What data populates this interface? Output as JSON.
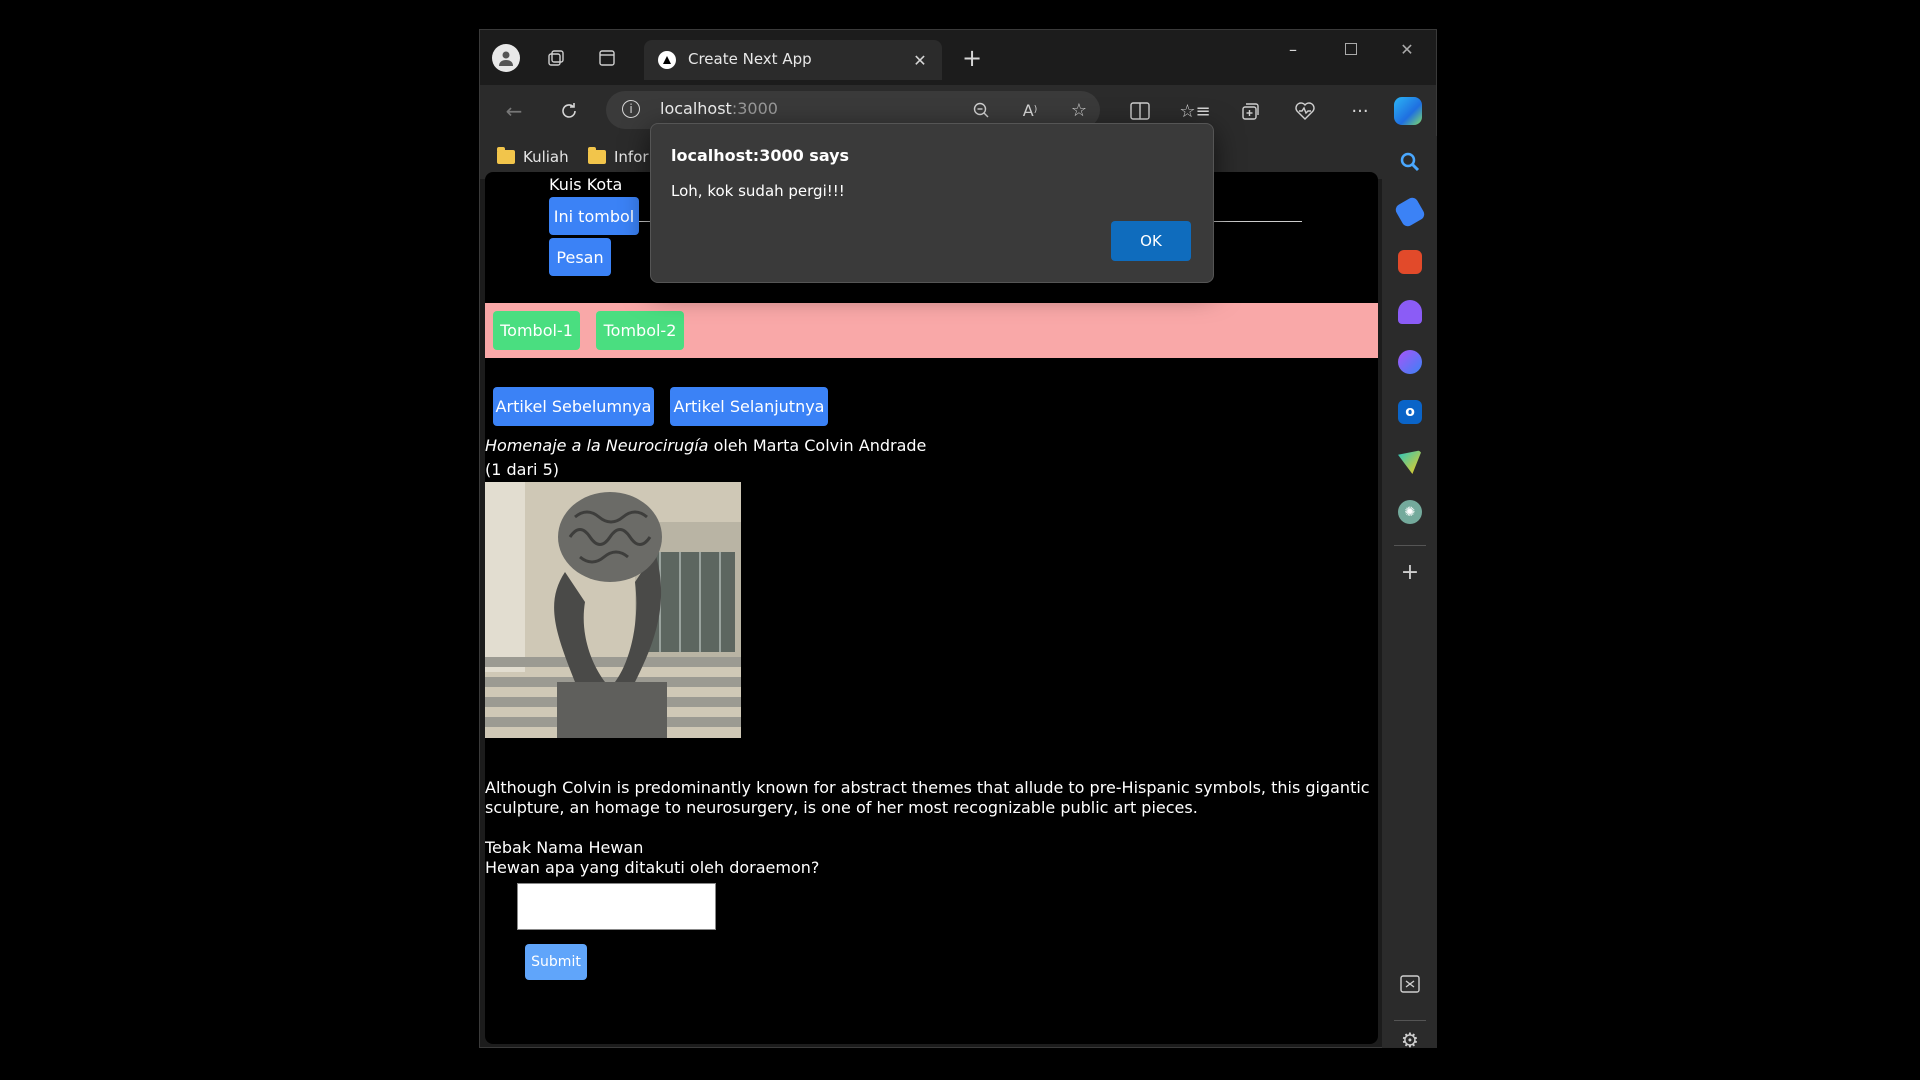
{
  "browser": {
    "tab_title": "Create Next App",
    "url_host": "localhost",
    "url_port": ":3000",
    "favorites": [
      "Kuliah",
      "Infor"
    ],
    "sidebar_icons": [
      "search-icon",
      "tag-icon",
      "toolbox-icon",
      "chess-icon",
      "copilot-icon",
      "outlook-icon",
      "send-icon",
      "chatgpt-icon",
      "add-icon",
      "screenshot-icon",
      "settings-icon"
    ]
  },
  "page": {
    "quiz_title": "Kuis Kota",
    "btn_ini_tombol": "Ini tombol",
    "btn_pesan": "Pesan",
    "btn_tombol1": "Tombol-1",
    "btn_tombol2": "Tombol-2",
    "btn_prev": "Artikel Sebelumnya",
    "btn_next": "Artikel Selanjutnya",
    "artwork_title": "Homenaje a la Neurocirugía",
    "artwork_by": " oleh Marta Colvin Andrade",
    "counter": "(1 dari 5)",
    "description_line1": "Although Colvin is predominantly known for abstract themes that allude to pre-Hispanic symbols, this gigantic",
    "description_line2": "sculpture, an homage to neurosurgery, is one of her most recognizable public art pieces.",
    "animal_quiz_title": "Tebak Nama Hewan",
    "animal_question": "Hewan apa yang ditakuti oleh doraemon?",
    "submit_label": "Submit"
  },
  "dialog": {
    "title": "localhost:3000 says",
    "message": "Loh, kok sudah pergi!!!",
    "ok_label": "OK"
  },
  "colors": {
    "blue_button": "#3b82f6",
    "green_button": "#4ade80",
    "pink_band": "#f9a8a8",
    "dialog_ok": "#0f6cbd"
  }
}
